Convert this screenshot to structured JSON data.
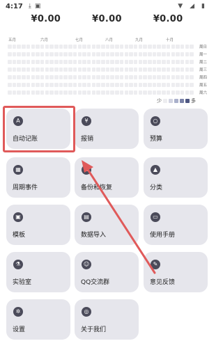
{
  "status_bar": {
    "time": "4:17",
    "icons": [
      "download-icon",
      "image-icon"
    ],
    "right_icons": [
      "wifi-icon",
      "signal-icon",
      "battery-icon"
    ]
  },
  "amounts": [
    "¥0.00",
    "¥0.00",
    "¥0.00"
  ],
  "heatmap": {
    "months": [
      "五月",
      "六月",
      "七月",
      "八月",
      "九月",
      "十月"
    ],
    "weekdays": [
      "周日",
      "周一",
      "周二",
      "周三",
      "周四",
      "周五",
      "周六"
    ],
    "legend": {
      "less": "少",
      "more": "多",
      "colors": [
        "#ededf0",
        "#d2d4e2",
        "#aab0cb",
        "#7a82a8",
        "#4e5782"
      ]
    },
    "cell_color": "#ededf0"
  },
  "tiles": [
    {
      "label": "自动记账",
      "icon": "auto-record-icon",
      "glyph": "A"
    },
    {
      "label": "报销",
      "icon": "reimburse-icon",
      "glyph": "¥"
    },
    {
      "label": "预算",
      "icon": "budget-icon",
      "glyph": "○"
    },
    {
      "label": "周期事件",
      "icon": "calendar-icon",
      "glyph": "▦"
    },
    {
      "label": "备份和恢复",
      "icon": "backup-icon",
      "glyph": "☁"
    },
    {
      "label": "分类",
      "icon": "category-icon",
      "glyph": "▲"
    },
    {
      "label": "模板",
      "icon": "template-icon",
      "glyph": "▣"
    },
    {
      "label": "数据导入",
      "icon": "import-icon",
      "glyph": "▤"
    },
    {
      "label": "使用手册",
      "icon": "manual-icon",
      "glyph": "▭"
    },
    {
      "label": "实验室",
      "icon": "lab-icon",
      "glyph": "⚗"
    },
    {
      "label": "QQ交流群",
      "icon": "group-icon",
      "glyph": "☺"
    },
    {
      "label": "意见反馈",
      "icon": "feedback-icon",
      "glyph": "✎"
    },
    {
      "label": "设置",
      "icon": "settings-icon",
      "glyph": "✲"
    },
    {
      "label": "关于我们",
      "icon": "about-icon",
      "glyph": "◎"
    }
  ],
  "colors": {
    "tile_bg": "#e6e6ec",
    "icon_bg": "#4b4b5a",
    "annotation_red": "#e05a5a"
  }
}
